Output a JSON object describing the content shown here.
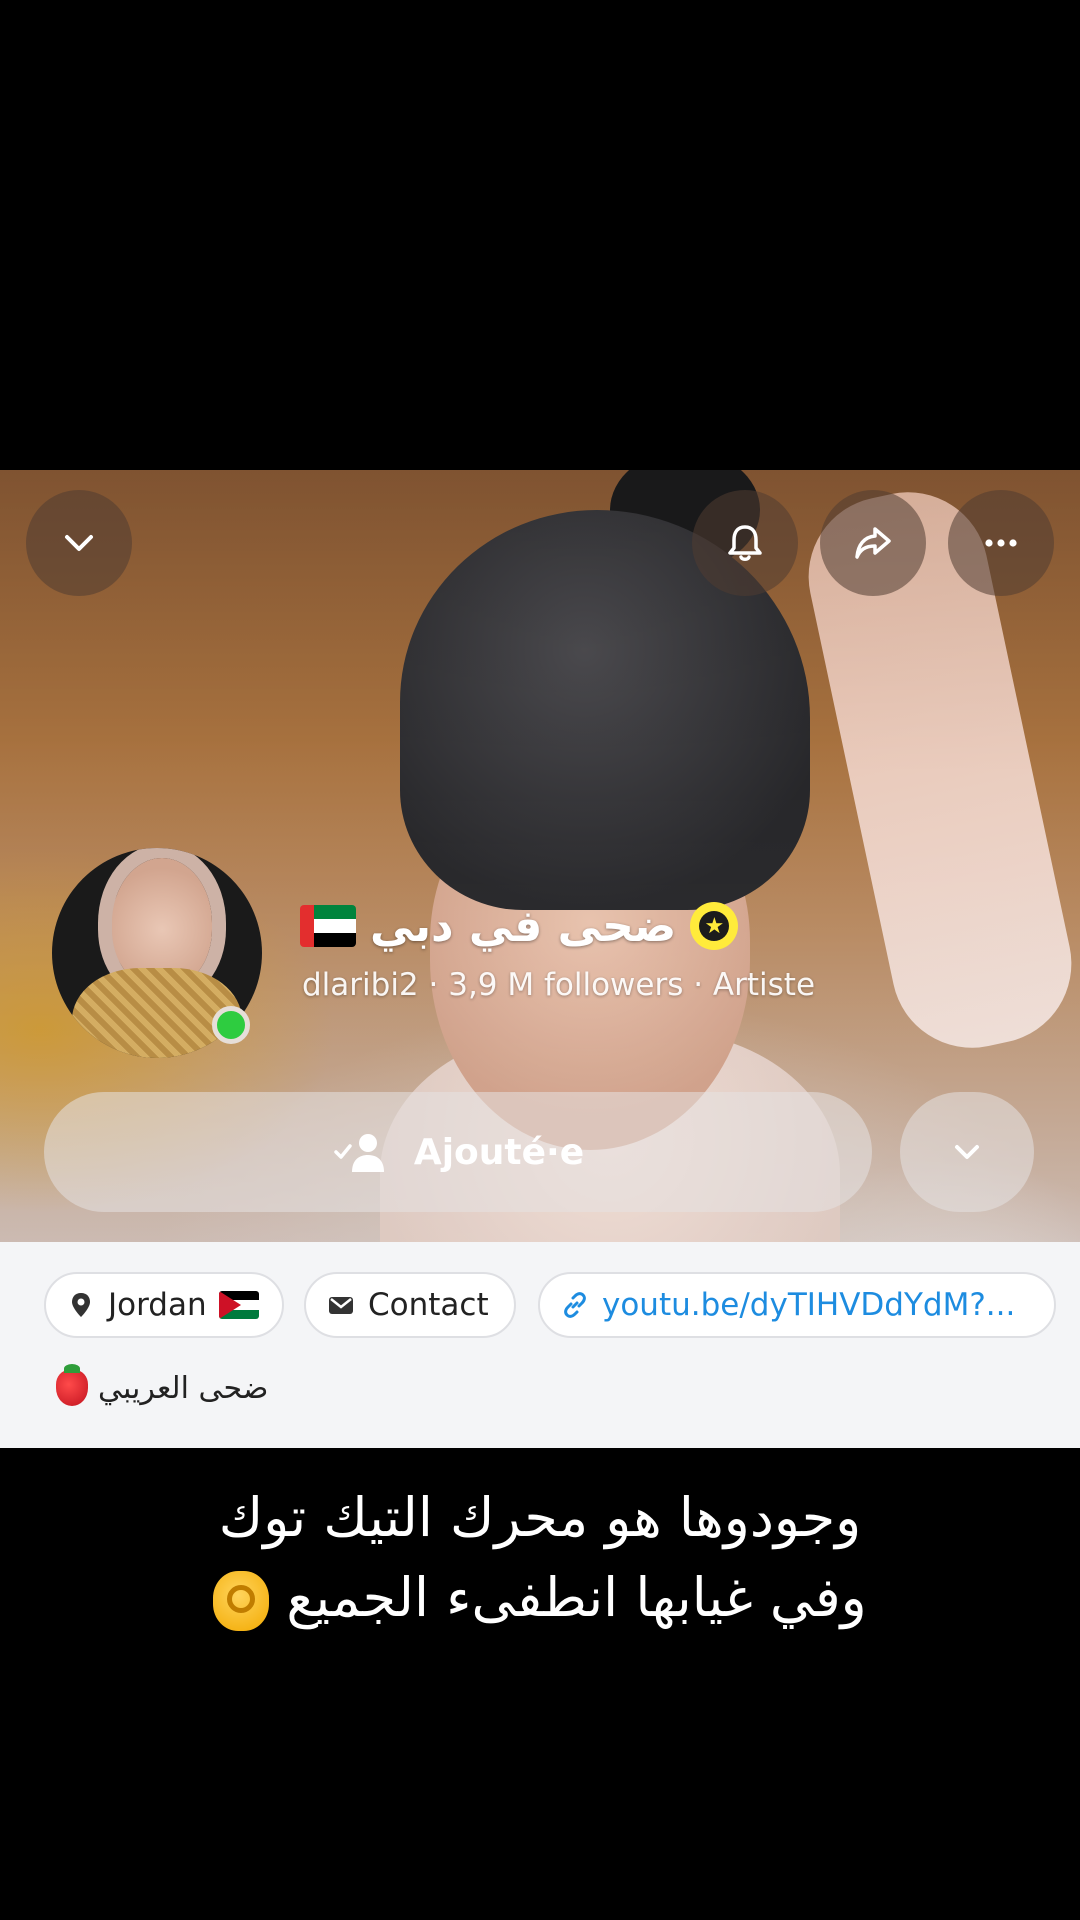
{
  "header": {
    "display_name": "ضحى في دبي",
    "username": "dlaribi2",
    "followers": "3,9 M followers",
    "category": "Artiste",
    "meta_line": "dlaribi2 · 3,9 M followers · Artiste"
  },
  "actions": {
    "added_label": "Ajouté·e"
  },
  "chips": {
    "location": "Jordan",
    "contact": "Contact",
    "link": "youtu.be/dyTIHVDdYdM?..."
  },
  "bio": {
    "text": "ضحى العريبي"
  },
  "caption": {
    "line1": "وجودوها هو محرك التيك توك",
    "line2": "وفي غيابها انطفىء الجميع"
  },
  "colors": {
    "online": "#2ecc40",
    "badge": "#ffeb3b",
    "link": "#1d8ce0"
  },
  "icons": [
    "chevron-down-icon",
    "bell-icon",
    "share-icon",
    "more-icon",
    "star-icon",
    "user-check-icon",
    "location-pin-icon",
    "envelope-icon",
    "link-icon"
  ]
}
